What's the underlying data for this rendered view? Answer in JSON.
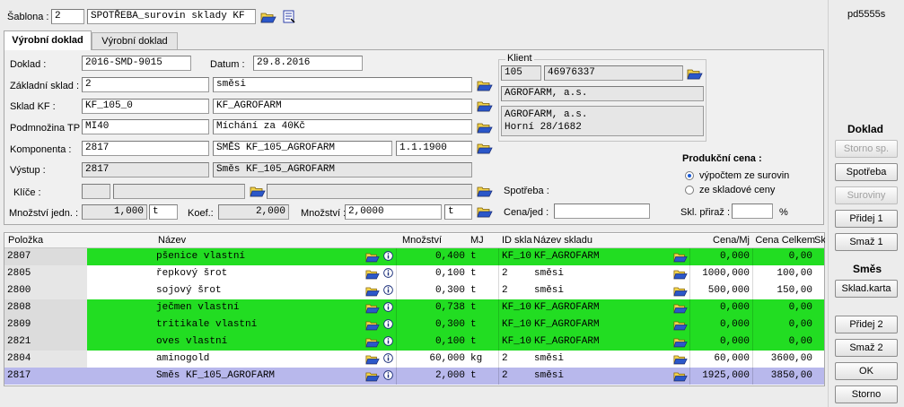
{
  "top": {
    "sablona_label": "Šablona :",
    "sablona_num": "2",
    "sablona_name": "SPOTŘEBA_surovin sklady KF",
    "id_code": "pd5555s"
  },
  "tabs": [
    {
      "label": "Výrobní doklad",
      "active": true
    },
    {
      "label": "Výrobní doklad",
      "active": false
    }
  ],
  "form": {
    "doklad_label": "Doklad :",
    "doklad": "2016-SMD-9015",
    "datum_label": "Datum :",
    "datum": "29.8.2016",
    "zakl_sklad_label": "Základní sklad :",
    "zakl_sklad": "2",
    "zakl_sklad_name": "směsi",
    "sklad_kf_label": "Sklad KF :",
    "sklad_kf": "KF_105_0",
    "sklad_kf_name": "KF_AGROFARM",
    "podmnozina_label": "Podmnožina TP :",
    "podmnozina": "MI40",
    "podmnozina_name": "Míchání za 40Kč",
    "komponenta_label": "Komponenta :",
    "komponenta": "2817",
    "komponenta_name": "SMĚS KF_105_AGROFARM",
    "komponenta_date": "1.1.1900",
    "vystup_label": "Výstup :",
    "vystup": "2817",
    "vystup_name": "Směs KF_105_AGROFARM",
    "klice_label": "Klíče :",
    "mnozstvi_jedn_label": "Množství jedn. :",
    "mnozstvi_jedn": "1,000",
    "mnozstvi_jedn_unit": "t",
    "koef_label": "Koef.:",
    "koef": "2,000",
    "mnozstvi_label": "Množství :",
    "mnozstvi": "2,0000",
    "mnozstvi_unit": "t"
  },
  "klient": {
    "legend": "Klient",
    "code": "105",
    "ico": "46976337",
    "name": "AGROFARM, a.s.",
    "addr1": "AGROFARM, a.s.",
    "addr2": "Horní 28/1682"
  },
  "produkce": {
    "title": "Produkční cena :",
    "opt1": "výpočtem ze surovin",
    "opt2": "ze skladové ceny",
    "spotreba_label": "Spotřeba :",
    "cena_jed_label": "Cena/jed :",
    "skl_priraz_label": "Skl. přiraž :",
    "percent": "%"
  },
  "grid": {
    "headers": [
      "Položka",
      "Název",
      "Množství",
      "MJ",
      "ID skla",
      "Název skladu",
      "Cena/Mj",
      "Cena Celkem",
      "Sk"
    ],
    "rows": [
      {
        "polozka": "2807",
        "nazev": "pšenice vlastní",
        "mnozstvi": "0,400",
        "mj": "t",
        "id": "KF_10",
        "sklad": "KF_AGROFARM",
        "cena": "0,000",
        "celkem": "0,00",
        "color": "#22dd22"
      },
      {
        "polozka": "2805",
        "nazev": "řepkový šrot",
        "mnozstvi": "0,100",
        "mj": "t",
        "id": "2",
        "sklad": "směsi",
        "cena": "1000,000",
        "celkem": "100,00",
        "color": "#ffffff"
      },
      {
        "polozka": "2800",
        "nazev": "sojový šrot",
        "mnozstvi": "0,300",
        "mj": "t",
        "id": "2",
        "sklad": "směsi",
        "cena": "500,000",
        "celkem": "150,00",
        "color": "#ffffff"
      },
      {
        "polozka": "2808",
        "nazev": "ječmen vlastní",
        "mnozstvi": "0,738",
        "mj": "t",
        "id": "KF_10",
        "sklad": "KF_AGROFARM",
        "cena": "0,000",
        "celkem": "0,00",
        "color": "#22dd22"
      },
      {
        "polozka": "2809",
        "nazev": "tritikale vlastní",
        "mnozstvi": "0,300",
        "mj": "t",
        "id": "KF_10",
        "sklad": "KF_AGROFARM",
        "cena": "0,000",
        "celkem": "0,00",
        "color": "#22dd22"
      },
      {
        "polozka": "2821",
        "nazev": "oves vlastní",
        "mnozstvi": "0,100",
        "mj": "t",
        "id": "KF_10",
        "sklad": "KF_AGROFARM",
        "cena": "0,000",
        "celkem": "0,00",
        "color": "#22dd22"
      },
      {
        "polozka": "2804",
        "nazev": "aminogold",
        "mnozstvi": "60,000",
        "mj": "kg",
        "id": "2",
        "sklad": "směsi",
        "cena": "60,000",
        "celkem": "3600,00",
        "color": "#ffffff"
      },
      {
        "polozka": "2817",
        "nazev": "Směs KF_105_AGROFARM",
        "mnozstvi": "2,000",
        "mj": "t",
        "id": "2",
        "sklad": "směsi",
        "cena": "1925,000",
        "celkem": "3850,00",
        "color": "#b8b8ec"
      }
    ]
  },
  "side": {
    "doklad_title": "Doklad",
    "storno_sp": "Storno sp.",
    "spotreba": "Spotřeba",
    "suroviny": "Suroviny",
    "pridej1": "Přidej 1",
    "smaz1": "Smaž 1",
    "smes_title": "Směs",
    "sklad_karta": "Sklad.karta",
    "pridej2": "Přidej 2",
    "smaz2": "Smaž 2",
    "ok": "OK",
    "storno": "Storno"
  },
  "icons": {
    "folder": "open-folder-icon",
    "info": "info-icon",
    "report": "report-icon"
  },
  "colors": {
    "green_row": "#22dd22",
    "selected_row": "#b8b8ec",
    "folder_yellow": "#f2d34a",
    "folder_blue": "#2b57c9"
  }
}
